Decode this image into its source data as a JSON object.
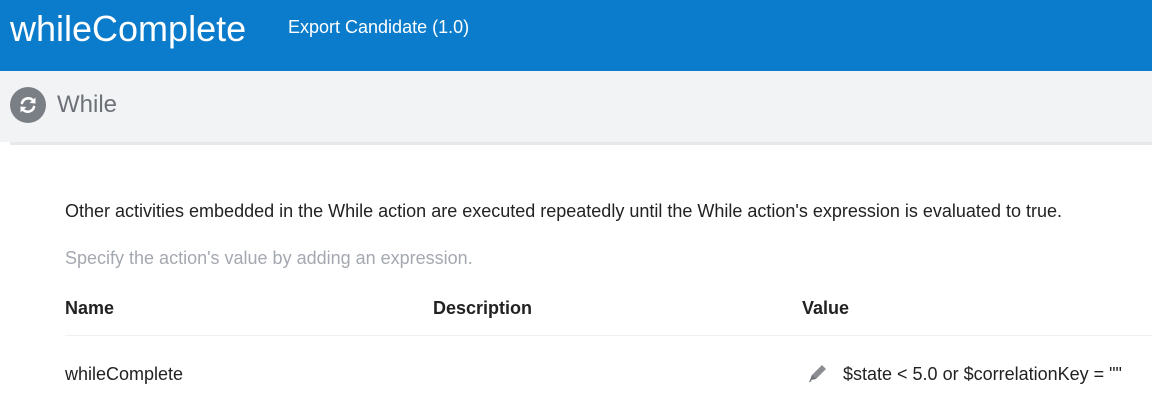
{
  "header": {
    "title": "whileComplete",
    "subtitle": "Export Candidate (1.0)",
    "background_color": "#0a7ccb"
  },
  "section": {
    "icon": "refresh-cycle-icon",
    "title": "While"
  },
  "content": {
    "description": "Other activities embedded in the While action are executed repeatedly until the While action's expression is evaluated to true.",
    "hint": "Specify the action's value by adding an expression."
  },
  "table": {
    "columns": [
      "Name",
      "Description",
      "Value"
    ],
    "rows": [
      {
        "name": "whileComplete",
        "description": "",
        "value": "$state < 5.0 or $correlationKey = \"\"",
        "edit_icon": "pencil-icon"
      }
    ]
  }
}
